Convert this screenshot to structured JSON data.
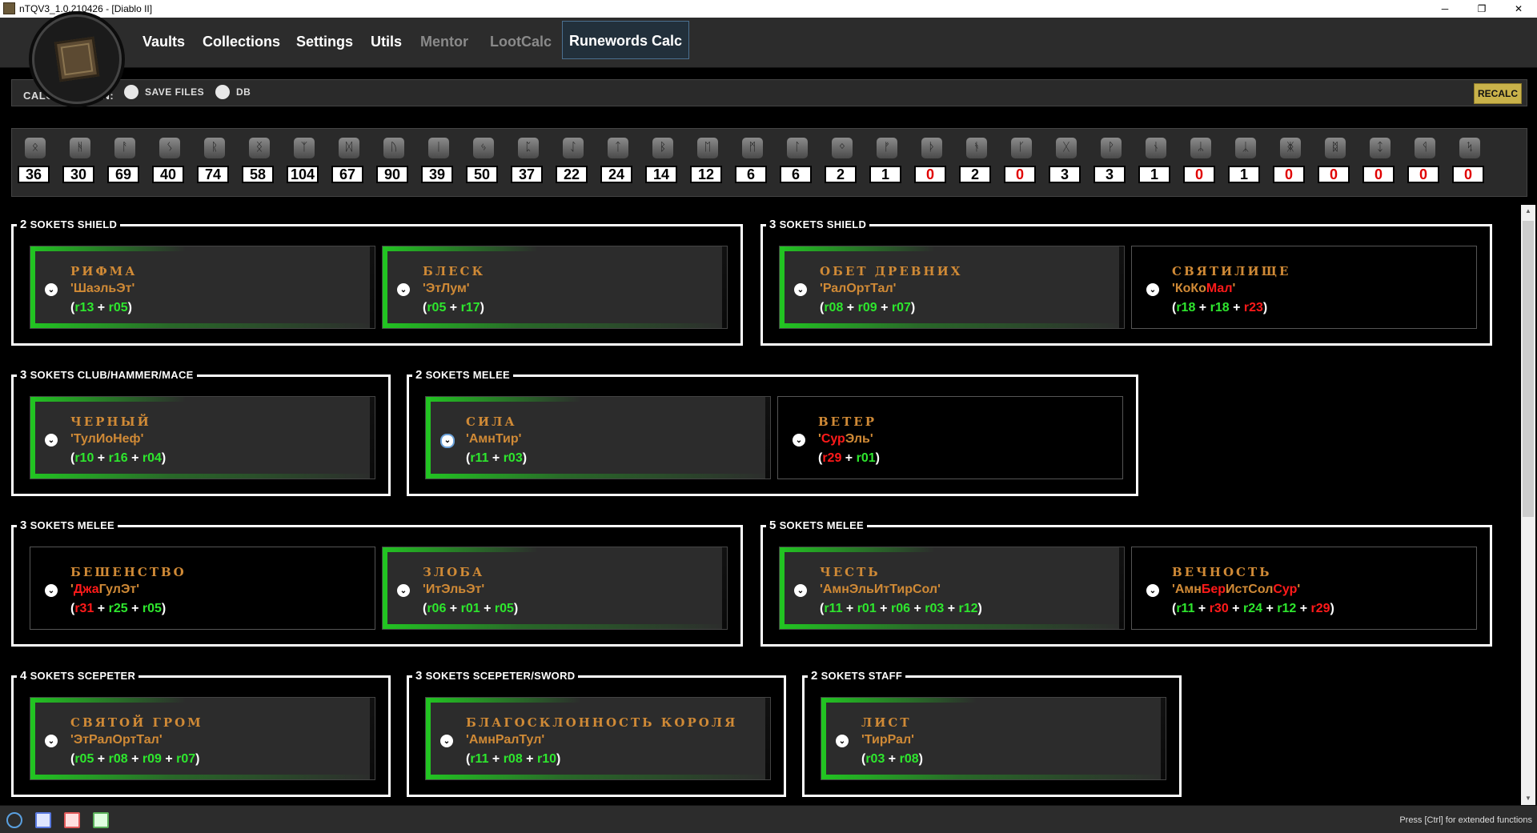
{
  "window": {
    "title": "nTQV3_1.0.210426 - [Diablo II]",
    "minimize": "─",
    "maximize": "❐",
    "close": "✕"
  },
  "menu": {
    "vaults": "Vaults",
    "collections": "Collections",
    "settings": "Settings",
    "utils": "Utils",
    "mentor": "Mentor",
    "lootcalc": "LootCalc",
    "runewords": "Runewords Calc"
  },
  "calc": {
    "label": "CALC RUNES IN:",
    "save_files": "SAVE FILES",
    "db": "DB",
    "recalc": "RECALC"
  },
  "runes": [
    {
      "glyph": "ᛟ",
      "count": "36"
    },
    {
      "glyph": "ᚻ",
      "count": "30"
    },
    {
      "glyph": "ᚨ",
      "count": "69"
    },
    {
      "glyph": "ᛊ",
      "count": "40"
    },
    {
      "glyph": "ᚱ",
      "count": "74"
    },
    {
      "glyph": "ᛝ",
      "count": "58"
    },
    {
      "glyph": "ᛉ",
      "count": "104"
    },
    {
      "glyph": "ᛞ",
      "count": "67"
    },
    {
      "glyph": "ᚢ",
      "count": "90"
    },
    {
      "glyph": "ᛁ",
      "count": "39"
    },
    {
      "glyph": "ᛃ",
      "count": "50"
    },
    {
      "glyph": "ᛈ",
      "count": "37"
    },
    {
      "glyph": "ᛇ",
      "count": "22"
    },
    {
      "glyph": "ᛏ",
      "count": "24"
    },
    {
      "glyph": "ᛒ",
      "count": "14"
    },
    {
      "glyph": "ᛖ",
      "count": "12"
    },
    {
      "glyph": "ᛗ",
      "count": "6"
    },
    {
      "glyph": "ᛚ",
      "count": "6"
    },
    {
      "glyph": "ᛜ",
      "count": "2"
    },
    {
      "glyph": "ᚠ",
      "count": "1"
    },
    {
      "glyph": "ᚦ",
      "count": "0"
    },
    {
      "glyph": "ᚬ",
      "count": "2"
    },
    {
      "glyph": "ᚴ",
      "count": "0"
    },
    {
      "glyph": "ᚷ",
      "count": "3"
    },
    {
      "glyph": "ᚹ",
      "count": "3"
    },
    {
      "glyph": "ᚾ",
      "count": "1"
    },
    {
      "glyph": "ᛦ",
      "count": "0"
    },
    {
      "glyph": "ᛣ",
      "count": "1"
    },
    {
      "glyph": "ᛤ",
      "count": "0"
    },
    {
      "glyph": "ᛥ",
      "count": "0"
    },
    {
      "glyph": "ᛨ",
      "count": "0"
    },
    {
      "glyph": "ᛩ",
      "count": "0"
    },
    {
      "glyph": "ᛪ",
      "count": "0"
    }
  ],
  "groups": [
    {
      "num": "2",
      "title": "SOKETS SHIELD",
      "cards": [
        {
          "name": "РИФМА",
          "runes": [
            {
              "t": "ШаэльЭт",
              "ok": true
            }
          ],
          "codes": [
            {
              "t": "r13",
              "ok": true
            },
            {
              "t": "r05",
              "ok": true
            }
          ],
          "done": true
        },
        {
          "name": "БЛЕСК",
          "runes": [
            {
              "t": "ЭтЛум",
              "ok": true
            }
          ],
          "codes": [
            {
              "t": "r05",
              "ok": true
            },
            {
              "t": "r17",
              "ok": true
            }
          ],
          "done": true
        }
      ]
    },
    {
      "num": "3",
      "title": "SOKETS SHIELD",
      "cards": [
        {
          "name": "ОБЕТ ДРЕВНИХ",
          "runes": [
            {
              "t": "РалОртТал",
              "ok": true
            }
          ],
          "codes": [
            {
              "t": "r08",
              "ok": true
            },
            {
              "t": "r09",
              "ok": true
            },
            {
              "t": "r07",
              "ok": true
            }
          ],
          "done": true
        },
        {
          "name": "СВЯТИЛИЩЕ",
          "runes": [
            {
              "t": "КоКо",
              "ok": true
            },
            {
              "t": "Мал",
              "ok": false
            }
          ],
          "codes": [
            {
              "t": "r18",
              "ok": true
            },
            {
              "t": "r18",
              "ok": true
            },
            {
              "t": "r23",
              "ok": false
            }
          ],
          "done": false
        }
      ]
    },
    {
      "num": "3",
      "title": "SOKETS CLUB/HAMMER/MACE",
      "cards": [
        {
          "name": "ЧЕРНЫЙ",
          "runes": [
            {
              "t": "ТулИоНеф",
              "ok": true
            }
          ],
          "codes": [
            {
              "t": "r10",
              "ok": true
            },
            {
              "t": "r16",
              "ok": true
            },
            {
              "t": "r04",
              "ok": true
            }
          ],
          "done": true
        }
      ]
    },
    {
      "num": "2",
      "title": "SOKETS MELEE",
      "cards": [
        {
          "name": "СИЛА",
          "runes": [
            {
              "t": "АмнТир",
              "ok": true
            }
          ],
          "codes": [
            {
              "t": "r11",
              "ok": true
            },
            {
              "t": "r03",
              "ok": true
            }
          ],
          "done": true
        },
        {
          "name": "ВЕТЕР",
          "runes": [
            {
              "t": "Сур",
              "ok": false
            },
            {
              "t": "Эль",
              "ok": true
            }
          ],
          "codes": [
            {
              "t": "r29",
              "ok": false
            },
            {
              "t": "r01",
              "ok": true
            }
          ],
          "done": false
        }
      ]
    },
    {
      "num": "3",
      "title": "SOKETS MELEE",
      "cards": [
        {
          "name": "БЕШЕНСТВО",
          "runes": [
            {
              "t": "Джа",
              "ok": false
            },
            {
              "t": "ГулЭт",
              "ok": true
            }
          ],
          "codes": [
            {
              "t": "r31",
              "ok": false
            },
            {
              "t": "r25",
              "ok": true
            },
            {
              "t": "r05",
              "ok": true
            }
          ],
          "done": false
        },
        {
          "name": "ЗЛОБА",
          "runes": [
            {
              "t": "ИтЭльЭт",
              "ok": true
            }
          ],
          "codes": [
            {
              "t": "r06",
              "ok": true
            },
            {
              "t": "r01",
              "ok": true
            },
            {
              "t": "r05",
              "ok": true
            }
          ],
          "done": true
        }
      ]
    },
    {
      "num": "5",
      "title": "SOKETS MELEE",
      "cards": [
        {
          "name": "ЧЕСТЬ",
          "runes": [
            {
              "t": "АмнЭльИтТирСол",
              "ok": true
            }
          ],
          "codes": [
            {
              "t": "r11",
              "ok": true
            },
            {
              "t": "r01",
              "ok": true
            },
            {
              "t": "r06",
              "ok": true
            },
            {
              "t": "r03",
              "ok": true
            },
            {
              "t": "r12",
              "ok": true
            }
          ],
          "done": true
        },
        {
          "name": "ВЕЧНОСТЬ",
          "runes": [
            {
              "t": "Амн",
              "ok": true
            },
            {
              "t": "Бер",
              "ok": false
            },
            {
              "t": "ИстСол",
              "ok": true
            },
            {
              "t": "Сур",
              "ok": false
            }
          ],
          "codes": [
            {
              "t": "r11",
              "ok": true
            },
            {
              "t": "r30",
              "ok": false
            },
            {
              "t": "r24",
              "ok": true
            },
            {
              "t": "r12",
              "ok": true
            },
            {
              "t": "r29",
              "ok": false
            }
          ],
          "done": false
        }
      ]
    },
    {
      "num": "4",
      "title": "SOKETS SCEPETER",
      "cards": [
        {
          "name": "СВЯТОЙ ГРОМ",
          "runes": [
            {
              "t": "ЭтРалОртТал",
              "ok": true
            }
          ],
          "codes": [
            {
              "t": "r05",
              "ok": true
            },
            {
              "t": "r08",
              "ok": true
            },
            {
              "t": "r09",
              "ok": true
            },
            {
              "t": "r07",
              "ok": true
            }
          ],
          "done": true
        }
      ]
    },
    {
      "num": "3",
      "title": "SOKETS SCEPETER/SWORD",
      "cards": [
        {
          "name": "БЛАГОСКЛОННОСТЬ КОРОЛЯ",
          "runes": [
            {
              "t": "АмнРалТул",
              "ok": true
            }
          ],
          "codes": [
            {
              "t": "r11",
              "ok": true
            },
            {
              "t": "r08",
              "ok": true
            },
            {
              "t": "r10",
              "ok": true
            }
          ],
          "done": true
        }
      ]
    },
    {
      "num": "2",
      "title": "SOKETS STAFF",
      "cards": [
        {
          "name": "ЛИСТ",
          "runes": [
            {
              "t": "ТирРал",
              "ok": true
            }
          ],
          "codes": [
            {
              "t": "r03",
              "ok": true
            },
            {
              "t": "r08",
              "ok": true
            }
          ],
          "done": true
        }
      ]
    }
  ],
  "footer": {
    "hint": "Press [Ctrl] for extended functions"
  },
  "colors": {
    "ok": "#2ee62e",
    "bad": "#ff1a1a",
    "name": "#d08a36",
    "accent_active": "#4b7090"
  }
}
